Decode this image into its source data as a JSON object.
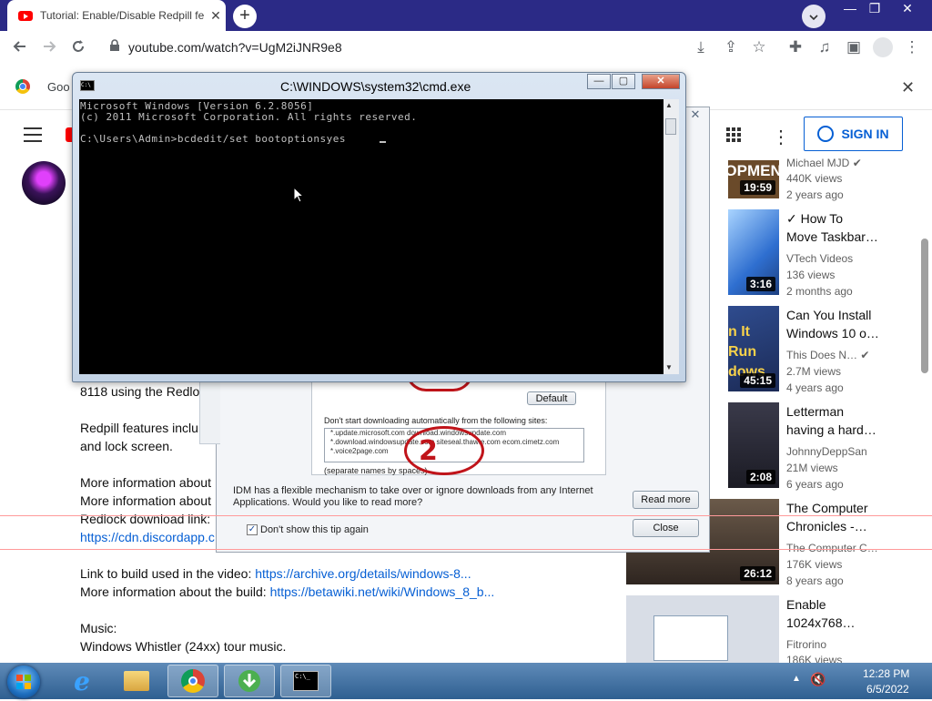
{
  "browser": {
    "tab_title": "Tutorial: Enable/Disable Redpill fe",
    "tab_close": "✕",
    "new_tab": "+",
    "url": "youtube.com/watch?v=UgM2iJNR9e8",
    "infobar_text": "Goo",
    "infobar_close": "✕"
  },
  "youtube": {
    "sign_in": "SIGN IN",
    "description": {
      "line1": "8118 using the Redlo",
      "line2": "Redpill features inclu",
      "line3": "and lock screen.",
      "line4": "More information about",
      "line5": "More information about",
      "line6": "Redlock download link:",
      "line7_link": "https://cdn.discordapp.c",
      "line8_prefix": "Link to build used in the video: ",
      "line8_link": "https://archive.org/details/windows-8...",
      "line9_prefix": "More information about the build: ",
      "line9_link": "https://betawiki.net/wiki/Windows_8_b...",
      "music_label": "Music:",
      "music_value": "Windows Whistler (24xx) tour music."
    },
    "recommendations": [
      {
        "thumb_text": "LOPMENT",
        "duration": "19:59",
        "title1": "",
        "title2": "",
        "channel": "Michael MJD",
        "verified": true,
        "views": "440K views",
        "age": "2 years ago",
        "thumb_color": "#6a4a2a"
      },
      {
        "thumb_text": "",
        "duration": "3:16",
        "title1": "✓ How To",
        "title2": "Move Taskbar…",
        "channel": "VTech Videos",
        "verified": false,
        "views": "136 views",
        "age": "2 months ago",
        "thumb_color": "#3c7fd6"
      },
      {
        "thumb_text": "n It Run dows",
        "duration": "45:15",
        "title1": "Can You Install",
        "title2": "Windows 10 o…",
        "channel": "This Does N…",
        "verified": true,
        "views": "2.7M views",
        "age": "4 years ago",
        "thumb_color": "#2f4c8f"
      },
      {
        "thumb_text": "",
        "duration": "2:08",
        "title1": "Letterman",
        "title2": "having a hard…",
        "channel": "JohnnyDeppSan",
        "verified": false,
        "views": "21M views",
        "age": "6 years ago",
        "thumb_color": "#2a2a3a"
      },
      {
        "thumb_text": "",
        "duration": "26:12",
        "title1": "The Computer",
        "title2": "Chronicles -…",
        "channel": "The Computer C…",
        "verified": false,
        "views": "176K views",
        "age": "8 years ago",
        "thumb_color": "#4a3a30"
      },
      {
        "thumb_text": "",
        "duration": "",
        "title1": "Enable",
        "title2": "1024x768…",
        "channel": "Fitrorino",
        "verified": false,
        "views": "186K views",
        "age": "",
        "thumb_color": "#d8dde6"
      }
    ]
  },
  "idm": {
    "default_btn": "Default",
    "dont_start_label": "Don't start downloading automatically from the following sites:",
    "sites": [
      "*.update.microsoft.com download.windowsupdate.com",
      "*.download.windowsupdate.com siteseal.thawte.com ecom.cimetz.com",
      "*.voice2page.com"
    ],
    "separate_hint": "(separate names by spaces)",
    "tip_text_1": "IDM has a flexible mechanism to take over or ignore downloads from any Internet",
    "tip_text_2": "Applications. Would you like to read more?",
    "read_more": "Read more",
    "close": "Close",
    "dont_show": "Don't show this tip again",
    "dont_show_checked": true,
    "annotation_number": "2",
    "close_x": "✕"
  },
  "cmd": {
    "title": "C:\\WINDOWS\\system32\\cmd.exe",
    "line1": "Microsoft Windows [Version 6.2.8056]",
    "line2": "(c) 2011 Microsoft Corporation. All rights reserved.",
    "line3": "C:\\Users\\Admin>bcdedit/set bootoptionsyes",
    "min": "—",
    "max": "▢",
    "close": "✕"
  },
  "taskbar": {
    "time": "12:28 PM",
    "date": "6/5/2022"
  },
  "colors": {
    "youtube_red": "#ff0000",
    "link_blue": "#065fd4",
    "annotation_red": "#c0141a",
    "taskbar": "#3a6ea5"
  }
}
